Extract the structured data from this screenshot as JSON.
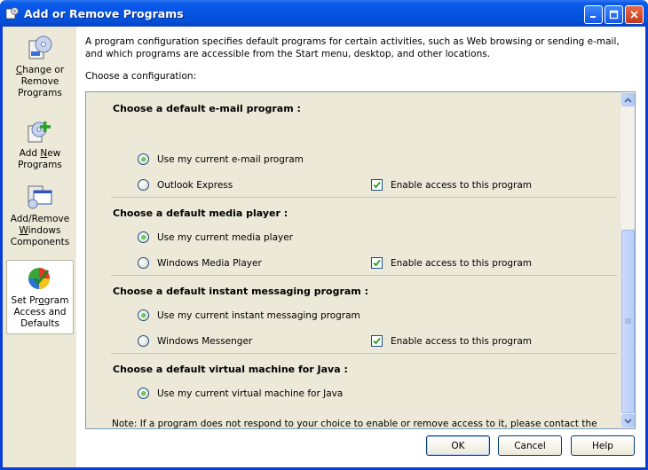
{
  "window": {
    "title": "Add or Remove Programs"
  },
  "sidebar": {
    "items": [
      {
        "label_html": "<span class=\"u\">C</span>hange or<br>Remove<br>Programs",
        "icon": "change-remove-programs-icon"
      },
      {
        "label_html": "Add <span class=\"u\">N</span>ew<br>Programs",
        "icon": "add-new-programs-icon"
      },
      {
        "label_html": "Add/Remove<br><span class=\"u\">W</span>indows<br>Components",
        "icon": "windows-components-icon"
      },
      {
        "label_html": "Set Pr<span class=\"u\">o</span>gram<br>Access and<br>Defaults",
        "icon": "set-program-access-icon",
        "selected": true
      }
    ]
  },
  "intro": "A program configuration specifies default programs for certain activities, such as Web browsing or sending e-mail, and which programs are accessible from the Start menu, desktop, and other locations.",
  "choose_label": "Choose a configuration:",
  "sections": [
    {
      "heading": "Choose a default e-mail program :",
      "option_current": "Use my current e-mail program",
      "option_alt": "Outlook Express",
      "enable_label": "Enable access to this program"
    },
    {
      "heading": "Choose a default media player :",
      "option_current": "Use my current media player",
      "option_alt": "Windows Media Player",
      "enable_label": "Enable access to this program"
    },
    {
      "heading": "Choose a default instant messaging program :",
      "option_current": "Use my current instant messaging program",
      "option_alt": "Windows Messenger",
      "enable_label": "Enable access to this program"
    },
    {
      "heading": "Choose a default virtual machine for Java :",
      "option_current": "Use my current virtual machine for Java"
    }
  ],
  "note": "Note: If a program does not respond to your choice to enable or remove access to it, please contact the vendor of that program.",
  "buttons": {
    "ok": "OK",
    "cancel": "Cancel",
    "help": "Help"
  },
  "colors": {
    "titlebar": "#0554e3",
    "panel": "#ece9d8",
    "radio_dot": "#21a121"
  }
}
